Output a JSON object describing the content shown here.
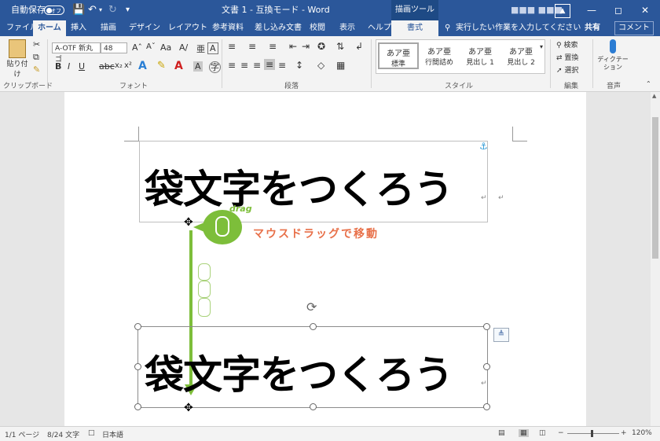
{
  "titlebar": {
    "autosave": "自動保存",
    "autosave_state": "オフ",
    "doc_title": "文書 1 - 互換モード - Word",
    "context_tab": "描画ツール",
    "user": "■■■ ■■■"
  },
  "tabs": [
    "ファイル",
    "ホーム",
    "挿入",
    "描画",
    "デザイン",
    "レイアウト",
    "参考資料",
    "差し込み文書",
    "校閲",
    "表示",
    "ヘルプ",
    "書式"
  ],
  "active_tab": "ホーム",
  "tell_me": "実行したい作業を入力してください",
  "share": "共有",
  "comment": "コメント",
  "ribbon": {
    "paste": "貼り付け",
    "clipboard": "クリップボード",
    "font_name": "A-OTF 新丸ゴ",
    "font_size": "48",
    "font_group": "フォント",
    "paragraph_group": "段落",
    "style_group": "スタイル",
    "edit_group": "編集",
    "voice_group": "音声",
    "styles": [
      {
        "sample": "あア亜",
        "name": "標準"
      },
      {
        "sample": "あア亜",
        "name": "行間詰め"
      },
      {
        "sample": "あア亜",
        "name": "見出し 1"
      },
      {
        "sample": "あア亜",
        "name": "見出し 2"
      }
    ],
    "find": "検索",
    "replace": "置換",
    "select": "選択",
    "dictate": "ディクテーション"
  },
  "document": {
    "headline_top": "袋文字をつくろう",
    "headline_bottom": "袋文字をつくろう",
    "drag_label": "drag",
    "annotation": "マウスドラッグで移動"
  },
  "status": {
    "page": "1/1 ページ",
    "words": "8/24 文字",
    "lang": "日本語",
    "zoom": "120%"
  },
  "colors": {
    "word_blue": "#2b579a",
    "arrow_green": "#7dbe3a",
    "annotation_orange": "#e87049"
  }
}
